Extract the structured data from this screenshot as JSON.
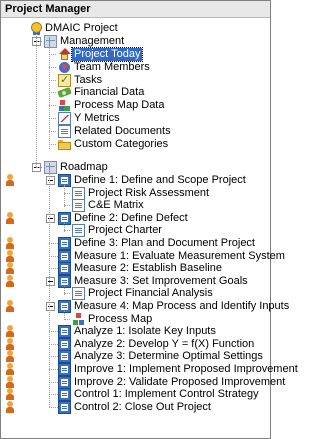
{
  "panel": {
    "title": "Project Manager"
  },
  "tree": {
    "root": "DMAIC Project",
    "management": {
      "label": "Management",
      "items": [
        {
          "label": "Project Today",
          "icon": "home-icon",
          "selected": true
        },
        {
          "label": "Team Members",
          "icon": "team-icon"
        },
        {
          "label": "Tasks",
          "icon": "tasks-icon"
        },
        {
          "label": "Financial Data",
          "icon": "money-icon"
        },
        {
          "label": "Process Map Data",
          "icon": "process-map-icon"
        },
        {
          "label": "Y Metrics",
          "icon": "chart-icon"
        },
        {
          "label": "Related Documents",
          "icon": "document-icon"
        },
        {
          "label": "Custom Categories",
          "icon": "folder-icon"
        }
      ]
    },
    "roadmap": {
      "label": "Roadmap",
      "steps": [
        {
          "label": "Define 1: Define and Scope Project",
          "children": [
            "Project Risk Assessment",
            "C&E Matrix"
          ]
        },
        {
          "label": "Define 2: Define Defect",
          "children": [
            "Project Charter"
          ]
        },
        {
          "label": "Define 3: Plan and Document Project",
          "children": []
        },
        {
          "label": "Measure 1: Evaluate Measurement System",
          "children": []
        },
        {
          "label": "Measure 2: Establish Baseline",
          "children": []
        },
        {
          "label": "Measure 3: Set Improvement Goals",
          "children": [
            "Project Financial Analysis"
          ]
        },
        {
          "label": "Measure 4: Map Process and Identify Inputs",
          "children": [
            "Process Map"
          ]
        },
        {
          "label": "Analyze 1: Isolate Key Inputs",
          "children": []
        },
        {
          "label": "Analyze 2: Develop Y = f(X) Function",
          "children": []
        },
        {
          "label": "Analyze 3: Determine Optimal Settings",
          "children": []
        },
        {
          "label": "Improve 1: Implement Proposed Improvement",
          "children": []
        },
        {
          "label": "Improve 2: Validate Proposed Improvement",
          "children": []
        },
        {
          "label": "Control 1: Implement Control Strategy",
          "children": []
        },
        {
          "label": "Control 2: Close Out Project",
          "children": []
        }
      ]
    }
  }
}
